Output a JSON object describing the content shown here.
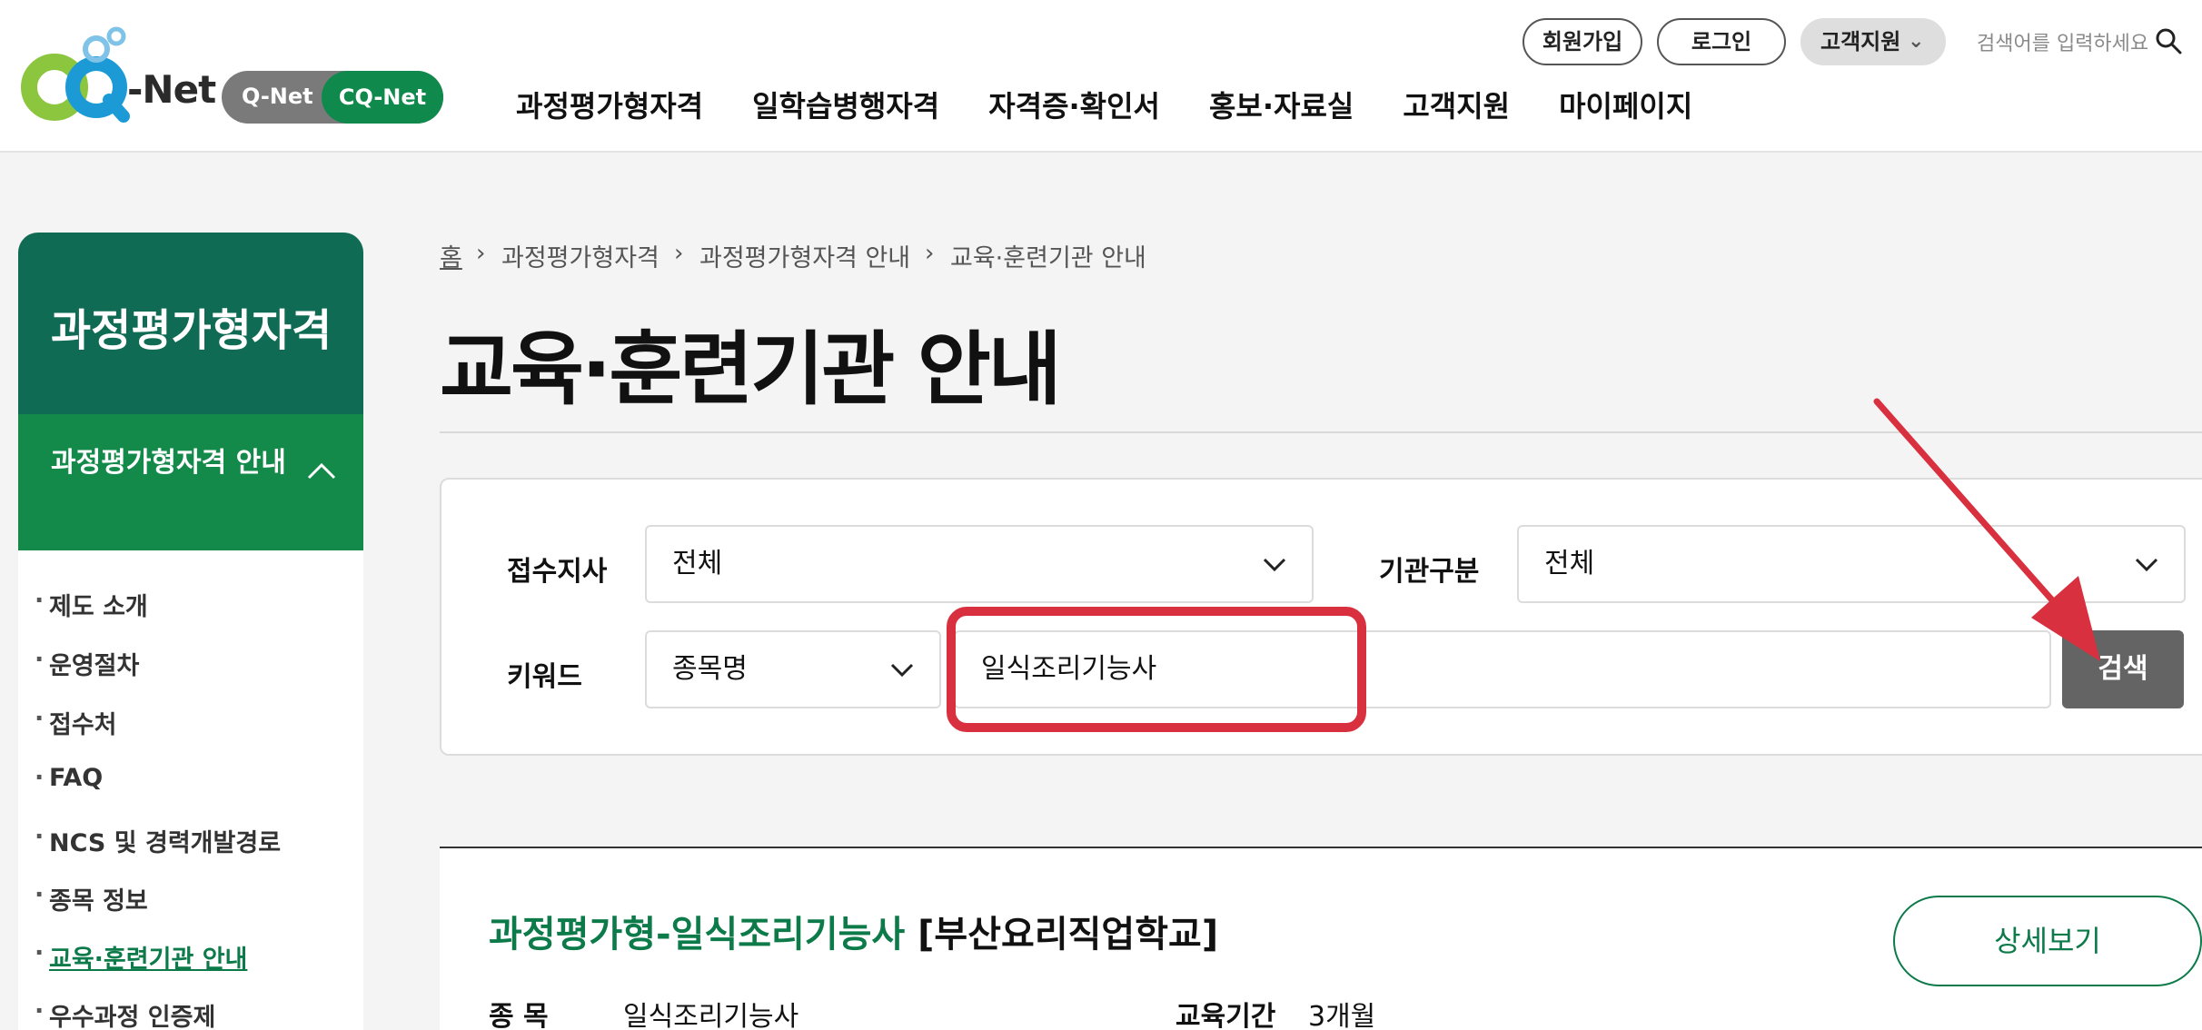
{
  "header": {
    "logo_text": "-Net",
    "toggle": {
      "off_label": "Q-Net",
      "on_label": "CQ-Net"
    },
    "nav": [
      "과정평가형자격",
      "일학습병행자격",
      "자격증·확인서",
      "홍보·자료실",
      "고객지원",
      "마이페이지"
    ],
    "util": {
      "join": "회원가입",
      "login": "로그인",
      "support": "고객지원"
    },
    "search_placeholder": "검색어를 입력하세요"
  },
  "sidebar": {
    "title": "과정평가형자격",
    "section": "과정평가형자격 안내",
    "items": [
      "제도 소개",
      "운영절차",
      "접수처",
      "FAQ",
      "NCS 및 경력개발경로",
      "종목 정보",
      "교육·훈련기관 안내",
      "우수과정 인증제"
    ],
    "active_index": 6
  },
  "breadcrumb": [
    "홈",
    "과정평가형자격",
    "과정평가형자격 안내",
    "교육·훈련기관 안내"
  ],
  "page_title": "교육·훈련기관 안내",
  "search_form": {
    "branch_label": "접수지사",
    "branch_value": "전체",
    "type_label": "기관구분",
    "type_value": "전체",
    "keyword_label": "키워드",
    "keyword_type": "종목명",
    "keyword_value": "일식조리기능사",
    "search_button": "검색"
  },
  "result": {
    "title": "과정평가형-일식조리기능사",
    "org": "[부산요리직업학교]",
    "detail_button": "상세보기",
    "field_label": "종 목",
    "field_value": "일식조리기능사",
    "period_label": "교육기간",
    "period_value": "3개월"
  },
  "colors": {
    "brand_green": "#13894a",
    "dark_green": "#0f6b54",
    "highlight_red": "#d9303f"
  }
}
